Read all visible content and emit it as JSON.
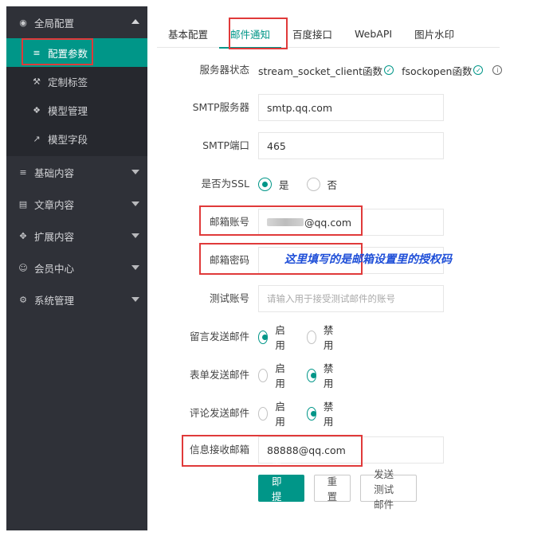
{
  "sidebar": {
    "groups": [
      {
        "label": "全局配置",
        "icon": "circle-settings-icon",
        "expanded": true,
        "items": [
          {
            "label": "配置参数",
            "icon": "sliders-icon",
            "active": true
          },
          {
            "label": "定制标签",
            "icon": "wrench-icon"
          },
          {
            "label": "模型管理",
            "icon": "cube-icon"
          },
          {
            "label": "模型字段",
            "icon": "external-link-icon"
          }
        ]
      },
      {
        "label": "基础内容",
        "icon": "sliders-icon"
      },
      {
        "label": "文章内容",
        "icon": "document-icon"
      },
      {
        "label": "扩展内容",
        "icon": "expand-icon"
      },
      {
        "label": "会员中心",
        "icon": "user-icon"
      },
      {
        "label": "系统管理",
        "icon": "gear-icon"
      }
    ]
  },
  "tabs": [
    {
      "label": "基本配置"
    },
    {
      "label": "邮件通知",
      "active": true
    },
    {
      "label": "百度接口"
    },
    {
      "label": "WebAPI"
    },
    {
      "label": "图片水印"
    }
  ],
  "form": {
    "server_status": {
      "label": "服务器状态",
      "items": [
        "stream_socket_client函数",
        "fsockopen函数"
      ]
    },
    "smtp_server": {
      "label": "SMTP服务器",
      "value": "smtp.qq.com"
    },
    "smtp_port": {
      "label": "SMTP端口",
      "value": "465"
    },
    "ssl": {
      "label": "是否为SSL",
      "options": [
        "是",
        "否"
      ],
      "selected": 0
    },
    "email_account": {
      "label": "邮箱账号",
      "value_suffix": "@qq.com"
    },
    "email_password": {
      "label": "邮箱密码",
      "value": ""
    },
    "test_account": {
      "label": "测试账号",
      "placeholder": "请输入用于接受测试邮件的账号"
    },
    "msg_email": {
      "label": "留言发送邮件",
      "options": [
        "启用",
        "禁用"
      ],
      "selected": 0
    },
    "form_email": {
      "label": "表单发送邮件",
      "options": [
        "启用",
        "禁用"
      ],
      "selected": 1
    },
    "comment_email": {
      "label": "评论发送邮件",
      "options": [
        "启用",
        "禁用"
      ],
      "selected": 1
    },
    "receive_email": {
      "label": "信息接收邮箱",
      "value": "88888@qq.com"
    }
  },
  "buttons": {
    "submit": "立即提交",
    "reset": "重置",
    "send_test": "发送测试邮件"
  },
  "annotation_note": "这里填写的是邮箱设置里的授权码",
  "colors": {
    "accent": "#009688",
    "sidebar_bg": "#2f3138",
    "highlight": "#e03a3a",
    "note": "#1f4fd8"
  }
}
